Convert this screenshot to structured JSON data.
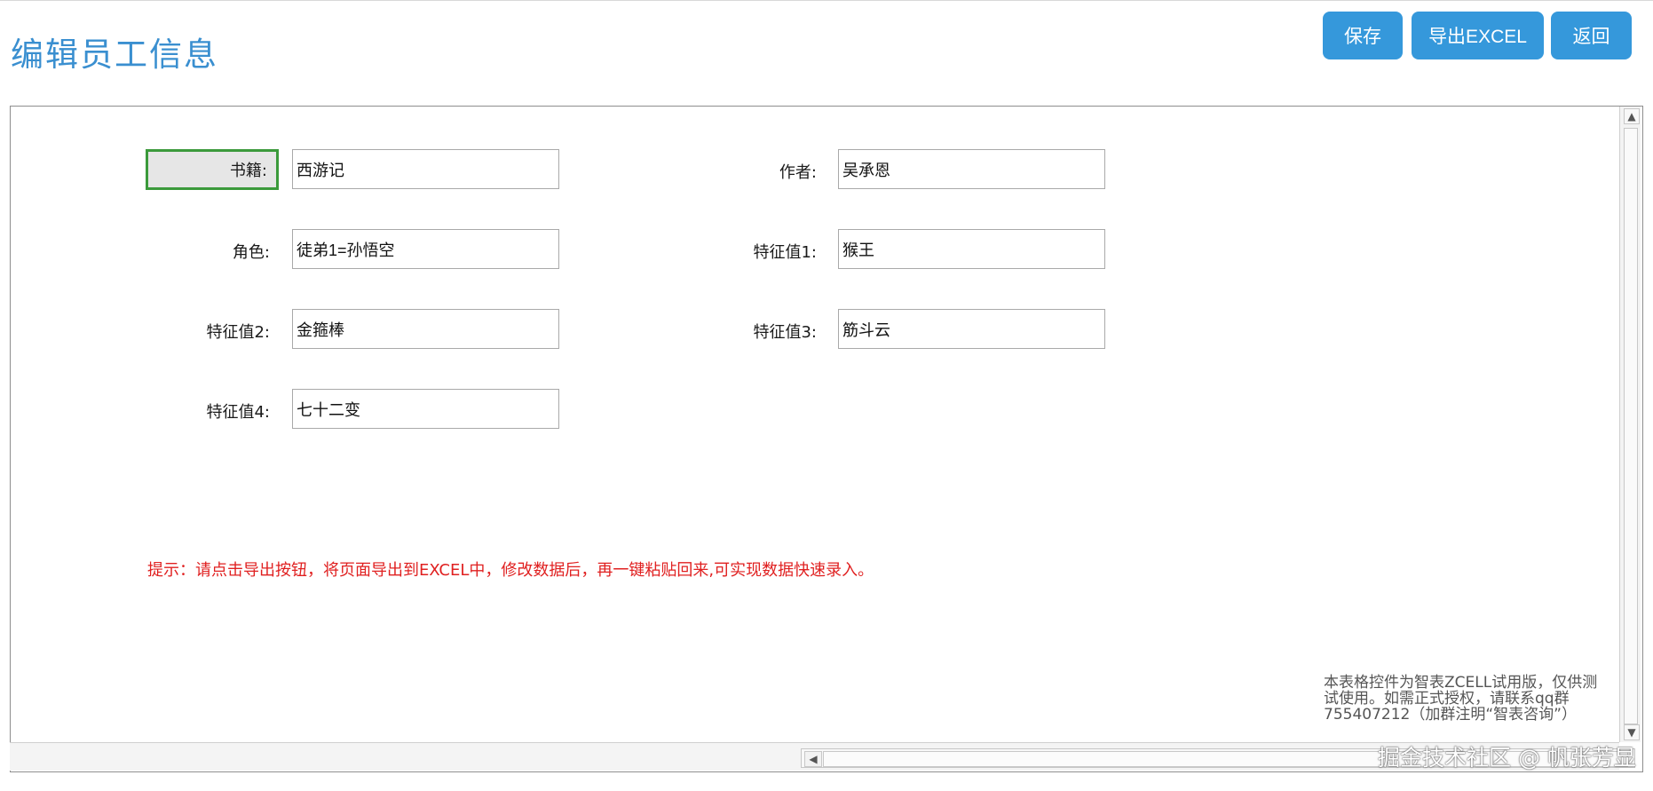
{
  "header": {
    "title": "编辑员工信息",
    "buttons": {
      "save": "保存",
      "export": "导出EXCEL",
      "back": "返回"
    }
  },
  "form": {
    "book": {
      "label": "书籍:",
      "value": "西游记"
    },
    "author": {
      "label": "作者:",
      "value": "吴承恩"
    },
    "role": {
      "label": "角色:",
      "value": "徒弟1=孙悟空"
    },
    "feature1": {
      "label": "特征值1:",
      "value": "猴王"
    },
    "feature2": {
      "label": "特征值2:",
      "value": "金箍棒"
    },
    "feature3": {
      "label": "特征值3:",
      "value": "筋斗云"
    },
    "feature4": {
      "label": "特征值4:",
      "value": "七十二变"
    }
  },
  "hint": "提示：请点击导出按钮，将页面导出到EXCEL中，修改数据后，再一键粘贴回来,可实现数据快速录入。",
  "trial_notice": "本表格控件为智表ZCELL试用版，仅供测试使用。如需正式授权，请联系qq群755407212（加群注明“智表咨询”）",
  "watermark": "掘金技术社区 @ 帆张芳显",
  "colors": {
    "accent": "#3598db",
    "hint": "#e02020",
    "selection": "#3b9a3b"
  }
}
